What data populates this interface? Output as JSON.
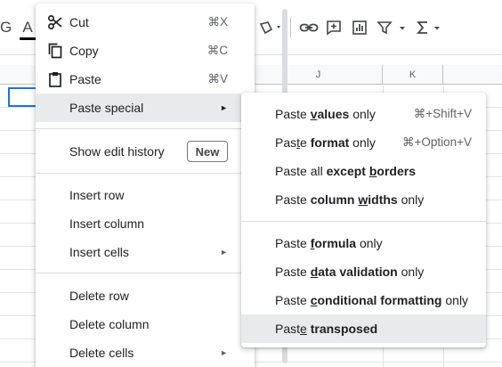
{
  "sheet": {
    "toolbar": {
      "g_letter": "G",
      "text_color_glyph": "A",
      "icons": [
        "text-color-icon",
        "fill-color-icon",
        "link-icon",
        "insert-comment-icon",
        "insert-chart-icon",
        "filter-icon",
        "functions-icon"
      ]
    },
    "columns": [
      {
        "label": "J"
      },
      {
        "label": "K"
      }
    ]
  },
  "main_menu": {
    "items": [
      {
        "label": "Cut",
        "shortcut": "⌘X",
        "icon": "scissors-icon"
      },
      {
        "label": "Copy",
        "shortcut": "⌘C",
        "icon": "copy-icon"
      },
      {
        "label": "Paste",
        "shortcut": "⌘V",
        "icon": "clipboard-icon"
      },
      {
        "label": "Paste special",
        "arrow": "►"
      },
      {
        "label": "Show edit history",
        "badge": "New"
      },
      {
        "label": "Insert row"
      },
      {
        "label": "Insert column"
      },
      {
        "label": "Insert cells",
        "arrow": "►"
      },
      {
        "label": "Delete row"
      },
      {
        "label": "Delete column"
      },
      {
        "label": "Delete cells",
        "arrow": "►"
      }
    ]
  },
  "submenu": {
    "items": [
      {
        "pre": "Paste ",
        "bold_pre": "",
        "u": "v",
        "bold_post": "alues",
        "post": " only",
        "shortcut": "⌘+Shift+V"
      },
      {
        "pre": "Pas",
        "u_plain": "t",
        "pre2": "e ",
        "bold": "format",
        "post": " only",
        "shortcut": "⌘+Option+V"
      },
      {
        "pre": "Paste all ",
        "bold_a": "except ",
        "u": "b",
        "bold_b": "orders",
        "post": ""
      },
      {
        "pre": "Paste ",
        "bold_a": "column ",
        "u": "w",
        "bold_b": "idths",
        "post": " only"
      },
      {
        "pre": "Paste ",
        "u": "f",
        "bold_b": "ormula",
        "post": " only"
      },
      {
        "pre": "Paste ",
        "u": "d",
        "bold_b": "ata validation",
        "post": " only"
      },
      {
        "pre": "Paste ",
        "u": "c",
        "bold_b": "onditional formatting",
        "post": " only"
      },
      {
        "pre": "Past",
        "u_plain": "e",
        "pre2": " ",
        "bold": "transposed",
        "post": ""
      }
    ]
  },
  "colors": {
    "menu_bg": "#ffffff",
    "hover_bg": "#e8eaed",
    "text": "#202124",
    "shortcut": "#5f6368",
    "selection": "#1a73e8"
  }
}
